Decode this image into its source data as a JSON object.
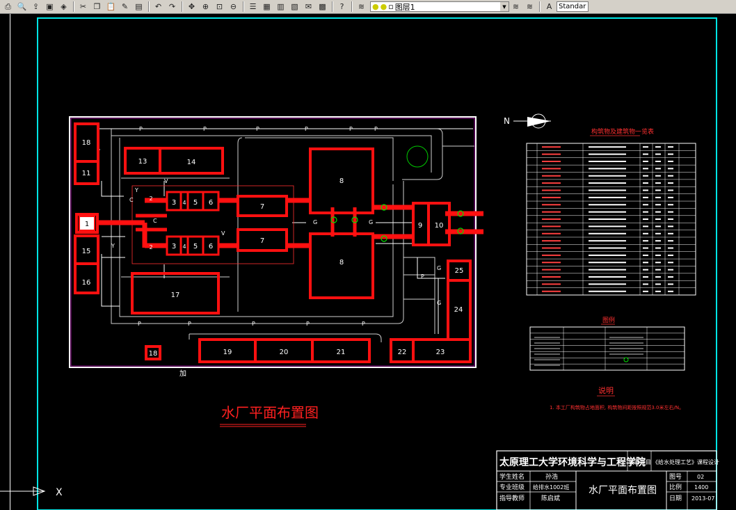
{
  "toolbar": {
    "layer_name": "图层1",
    "text_style": "Standar",
    "icons": [
      "print-icon",
      "print-preview-icon",
      "publish-icon",
      "plot-icon",
      "3d-dwf-icon",
      "cut-icon",
      "copy-icon",
      "paste-icon",
      "match-properties-icon",
      "block-editor-icon",
      "undo-icon",
      "redo-icon",
      "pan-icon",
      "zoom-realtime-icon",
      "zoom-window-icon",
      "zoom-previous-icon",
      "properties-icon",
      "design-center-icon",
      "tool-palette-icon",
      "sheet-set-icon",
      "markup-icon",
      "calculator-icon",
      "help-icon"
    ]
  },
  "plan": {
    "north_label": "N",
    "buildings": {
      "b1": "1",
      "b2a": "2",
      "b2b": "2",
      "b3a": "3",
      "b4a": "4",
      "b5a": "5",
      "b6a": "6",
      "b3b": "3",
      "b4b": "4",
      "b5b": "5",
      "b6b": "6",
      "b7a": "7",
      "b7b": "7",
      "b8a": "8",
      "b8b": "8",
      "b9": "9",
      "b10": "10",
      "b11": "11",
      "b12": "12",
      "b13": "13",
      "b14": "14",
      "b15": "15",
      "b16": "16",
      "b17": "17",
      "b18": "18",
      "b19": "19",
      "b20": "20",
      "b21": "21",
      "b22": "22",
      "b23": "23",
      "b24": "24",
      "b25": "25"
    },
    "pipe_labels": {
      "p": "P",
      "g": "G",
      "y": "Y",
      "v": "V",
      "c": "C"
    },
    "bottom_text": "加",
    "title": "水厂平面布置图",
    "top_right_label": "图例"
  },
  "table1": {
    "title": "构筑物及建筑物一览表",
    "rows": 21
  },
  "legend": {
    "title": "图例"
  },
  "notes": {
    "title": "说明",
    "text": "1. 本工厂构筑物占地面积, 构筑物间距按照规范3.0米左右/N。"
  },
  "titleblock": {
    "school": "太原理工大学环境科学与工程学院",
    "design_topic_label": "设计题目",
    "design_topic": "《给水处理工艺》课程设计",
    "student_label": "学生姓名",
    "student": "孙浩",
    "major_label": "专业班级",
    "major": "给排水1002班",
    "advisor_label": "指导教师",
    "advisor": "陈启斌",
    "drawing_name": "水厂平面布置图",
    "sheet_label": "图号",
    "sheet": "02",
    "scale_label": "比例",
    "scale": "1400",
    "date_label": "日期",
    "date": "2013-07"
  },
  "ucs": {
    "x_label": "X"
  }
}
